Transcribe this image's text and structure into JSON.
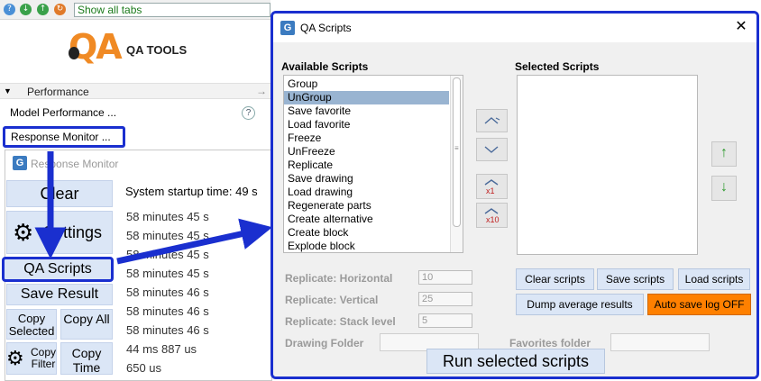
{
  "background": {
    "toolbar": {
      "filter_label": "Show all tabs"
    },
    "logo": {
      "text": "QA",
      "title": "QA TOOLS"
    },
    "section": {
      "label": "Performance"
    },
    "items": {
      "model_performance": "Model Performance ...",
      "response_monitor": "Response Monitor ..."
    },
    "help": "?"
  },
  "response_monitor": {
    "title": "Response Monitor",
    "buttons": {
      "clear": "Clear",
      "settings": "Settings",
      "qa_scripts": "QA Scripts",
      "save_result": "Save Result",
      "copy_selected": "Copy Selected",
      "copy_all": "Copy All",
      "copy_filter": "Copy Filter",
      "copy_time": "Copy Time"
    },
    "startup_label": "System startup time: 49 s",
    "entries": [
      "58 minutes 45 s",
      "58 minutes 45 s",
      "58 minutes 45 s",
      "58 minutes 45 s",
      "58 minutes 46 s",
      "58 minutes 46 s",
      "58 minutes 46 s",
      "44 ms 887 us",
      "650 us"
    ]
  },
  "dialog": {
    "title": "QA Scripts",
    "close": "✕",
    "available_header": "Available Scripts",
    "selected_header": "Selected Scripts",
    "available_scripts": [
      "Group",
      "UnGroup",
      "Save favorite",
      "Load favorite",
      "Freeze",
      "UnFreeze",
      "Replicate",
      "Save drawing",
      "Load drawing",
      "Regenerate parts",
      "Create alternative",
      "Create block",
      "Explode block"
    ],
    "selected_index": 1,
    "params": {
      "horizontal_label": "Replicate: Horizontal",
      "horizontal_value": "10",
      "vertical_label": "Replicate: Vertical",
      "vertical_value": "25",
      "stack_label": "Replicate: Stack level",
      "stack_value": "5"
    },
    "drawing_folder_label": "Drawing Folder",
    "favorites_folder_label": "Favorites folder",
    "buttons": {
      "clear_scripts": "Clear scripts",
      "save_scripts": "Save scripts",
      "load_scripts": "Load scripts",
      "dump_average": "Dump average results",
      "auto_save": "Auto save log OFF",
      "run": "Run selected scripts"
    },
    "move_buttons": {
      "x1": "x1",
      "x10": "x10"
    },
    "colors": {
      "highlight_border": "#1a2fcf",
      "auto_save_bg": "#ff8000",
      "selected_row": "#99b4d1",
      "button_bg": "#dbe6f6"
    }
  }
}
